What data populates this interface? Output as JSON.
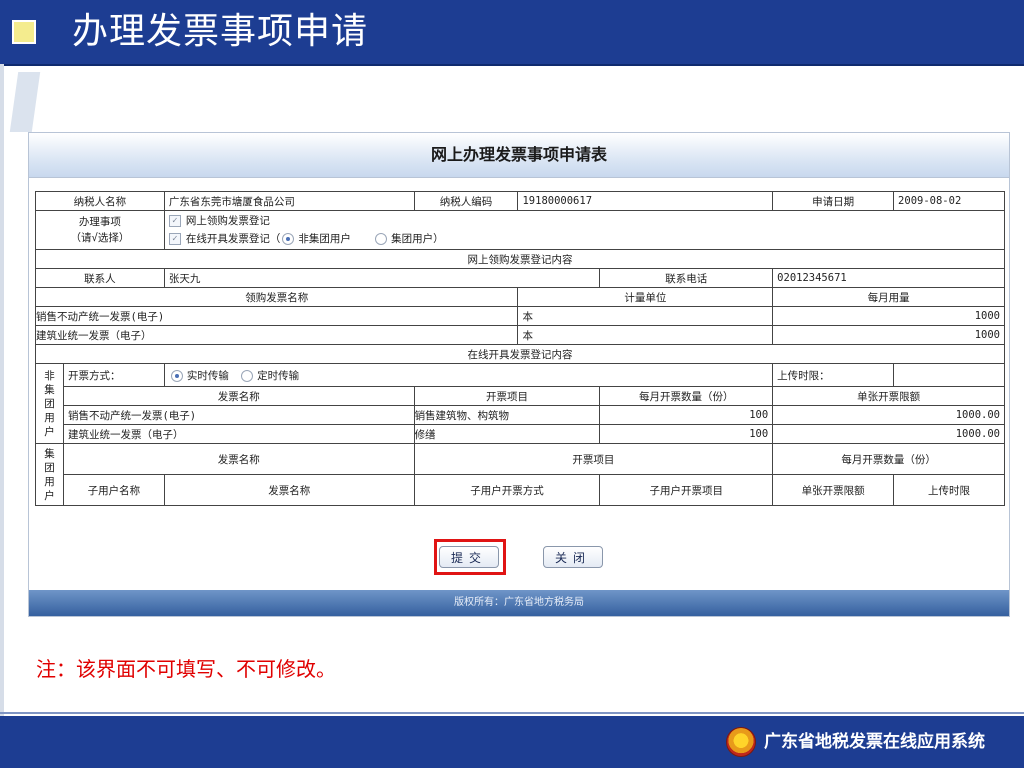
{
  "header": {
    "title": "办理发票事项申请"
  },
  "form": {
    "title": "网上办理发票事项申请表",
    "taxpayer_name_label": "纳税人名称",
    "taxpayer_name": "广东省东莞市塘厦食品公司",
    "taxpayer_code_label": "纳税人编码",
    "taxpayer_code": "19180000617",
    "apply_date_label": "申请日期",
    "apply_date": "2009-08-02",
    "matter_label_1": "办理事项",
    "matter_label_2": "（请√选择）",
    "option_purchase": "网上领购发票登记",
    "option_online_prefix": "在线开具发票登记（",
    "option_non_group": "非集团用户",
    "option_group": "集团用户）",
    "purchase_section": "网上领购发票登记内容",
    "contact_label": "联系人",
    "contact": "张天九",
    "phone_label": "联系电话",
    "phone": "02012345671",
    "invoice_name_label": "领购发票名称",
    "unit_label": "计量单位",
    "monthly_usage_label": "每月用量",
    "purchase_rows": [
      {
        "name": "销售不动产统一发票(电子)",
        "unit": "本",
        "usage": "1000"
      },
      {
        "name": "建筑业统一发票（电子）",
        "unit": "本",
        "usage": "1000"
      }
    ],
    "online_section": "在线开具发票登记内容",
    "non_group_label": [
      "非",
      "集",
      "团",
      "用",
      "户"
    ],
    "issue_mode_label": "开票方式：",
    "mode_realtime": "实时传输",
    "mode_scheduled": "定时传输",
    "upload_limit_label": "上传时限：",
    "invoice_col": "发票名称",
    "item_col": "开票项目",
    "monthly_count_col": "每月开票数量（份）",
    "single_limit_col": "单张开票限额",
    "online_rows": [
      {
        "name": "销售不动产统一发票(电子)",
        "item": "销售建筑物、构筑物",
        "count": "100",
        "limit": "1000.00"
      },
      {
        "name": "建筑业统一发票（电子）",
        "item": "修缮",
        "count": "100",
        "limit": "1000.00"
      }
    ],
    "group_label": [
      "集",
      "团",
      "用",
      "户"
    ],
    "sub_user_name_col": "子用户名称",
    "sub_mode_col": "子用户开票方式",
    "sub_item_col": "子用户开票项目",
    "upload_time_col": "上传时限"
  },
  "buttons": {
    "submit": "提交",
    "close": "关闭"
  },
  "footer": {
    "copyright": "版权所有：广东省地方税务局"
  },
  "note": "注：该界面不可填写、不可修改。",
  "bottom": {
    "system_name": "广东省地税发票在线应用系统"
  },
  "colors": {
    "header_blue": "#1d3d92",
    "highlight": "#e01414",
    "note_red": "#e00000"
  }
}
